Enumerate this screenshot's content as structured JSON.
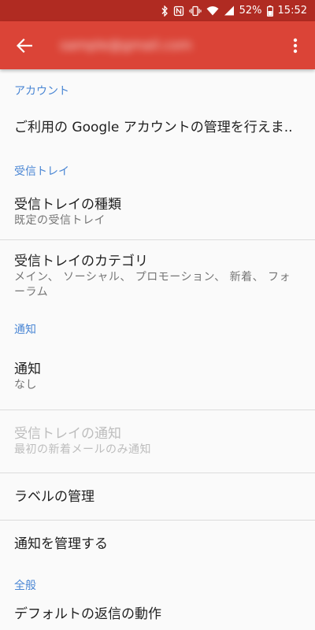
{
  "status_bar": {
    "battery": "52%",
    "time": "15:52"
  },
  "app_bar": {
    "account": "sample@gmail.com",
    "icons": {
      "back": "arrow-back-icon",
      "overflow": "more-vert-icon"
    }
  },
  "sections": {
    "account": {
      "header": "アカウント",
      "manage": "ご利用の Google アカウントの管理を行えま.."
    },
    "inbox": {
      "header": "受信トレイ",
      "type_title": "受信トレイの種類",
      "type_summary": "既定の受信トレイ",
      "categories_title": "受信トレイのカテゴリ",
      "categories_summary": "メイン、 ソーシャル、 プロモーション、 新着、 フォーラム"
    },
    "notifications": {
      "header": "通知",
      "notify_title": "通知",
      "notify_summary": "なし",
      "inbox_notify_title": "受信トレイの通知",
      "inbox_notify_summary": "最初の新着メールのみ通知",
      "labels_title": "ラベルの管理",
      "manage_title": "通知を管理する"
    },
    "general": {
      "header": "全般",
      "next_title": "デフォルトの返信の動作"
    }
  },
  "colors": {
    "app_bar": "#db4437",
    "status_bar": "#b02b22",
    "section_header": "#4a86d4"
  }
}
